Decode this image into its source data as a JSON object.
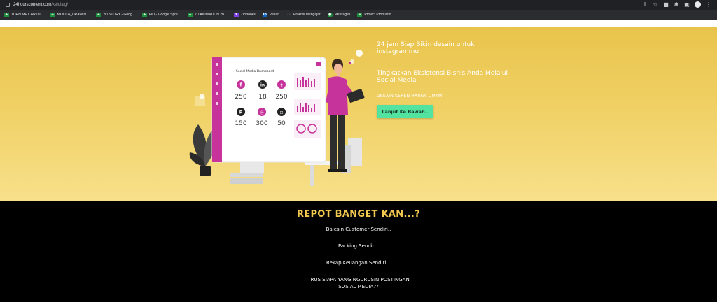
{
  "browser": {
    "url_domain": "24hourscontent.com",
    "url_path": "/kelolaig/",
    "bookmarks": [
      {
        "label": "TURN ME CARTO...",
        "icon": "sheets-icon"
      },
      {
        "label": "MOCCA_DRAWIN...",
        "icon": "sheets-icon"
      },
      {
        "label": "2D STORY - Goog...",
        "icon": "sheets-icon"
      },
      {
        "label": "FIO - Google Spre...",
        "icon": "sheets-icon"
      },
      {
        "label": "2D ANIMATION 20...",
        "icon": "sheets-icon"
      },
      {
        "label": "ZipBooks",
        "icon": "zipbooks-icon"
      },
      {
        "label": "Pesan",
        "icon": "linkedin-icon"
      },
      {
        "label": "Praktisi Mengajar",
        "icon": "dots-icon"
      },
      {
        "label": "Messages",
        "icon": "messages-icon"
      },
      {
        "label": "Project Productio...",
        "icon": "sheets-icon"
      }
    ]
  },
  "hero": {
    "headline": "24 jam Siap Bikin desain untuk instagrammu",
    "subheadline": "Tingkatkan Eksistensi Bisnis Anda Melalui Social Media",
    "tagline": "DESAIN KEREN HARGA UMKM",
    "cta_label": "Lanjut Ke Bawah..",
    "dashboard": {
      "title": "Social Media Dashboard",
      "stats": [
        {
          "network": "facebook",
          "glyph": "f",
          "value": "250"
        },
        {
          "network": "linkedin",
          "glyph": "in",
          "value": "18"
        },
        {
          "network": "twitter",
          "glyph": "t",
          "value": "250"
        },
        {
          "network": "pinterest",
          "glyph": "P",
          "value": "150"
        },
        {
          "network": "dribbble",
          "glyph": "◎",
          "value": "300"
        },
        {
          "network": "instagram",
          "glyph": "◻",
          "value": "50"
        }
      ]
    }
  },
  "section": {
    "title": "REPOT BANGET KAN...?",
    "lines": [
      "Balesin Customer Sendiri..",
      "Packing Sendiri..",
      "Rekap Keuangan Sendiri...",
      "TRUS SIAPA YANG NGURUSIN POSTINGAN",
      "SOSIAL MEDIA??"
    ]
  },
  "colors": {
    "hero_yellow": "#efcc5c",
    "cta_green": "#52e3a1",
    "title_gold": "#f3c94f",
    "accent_magenta": "#c6339b"
  }
}
